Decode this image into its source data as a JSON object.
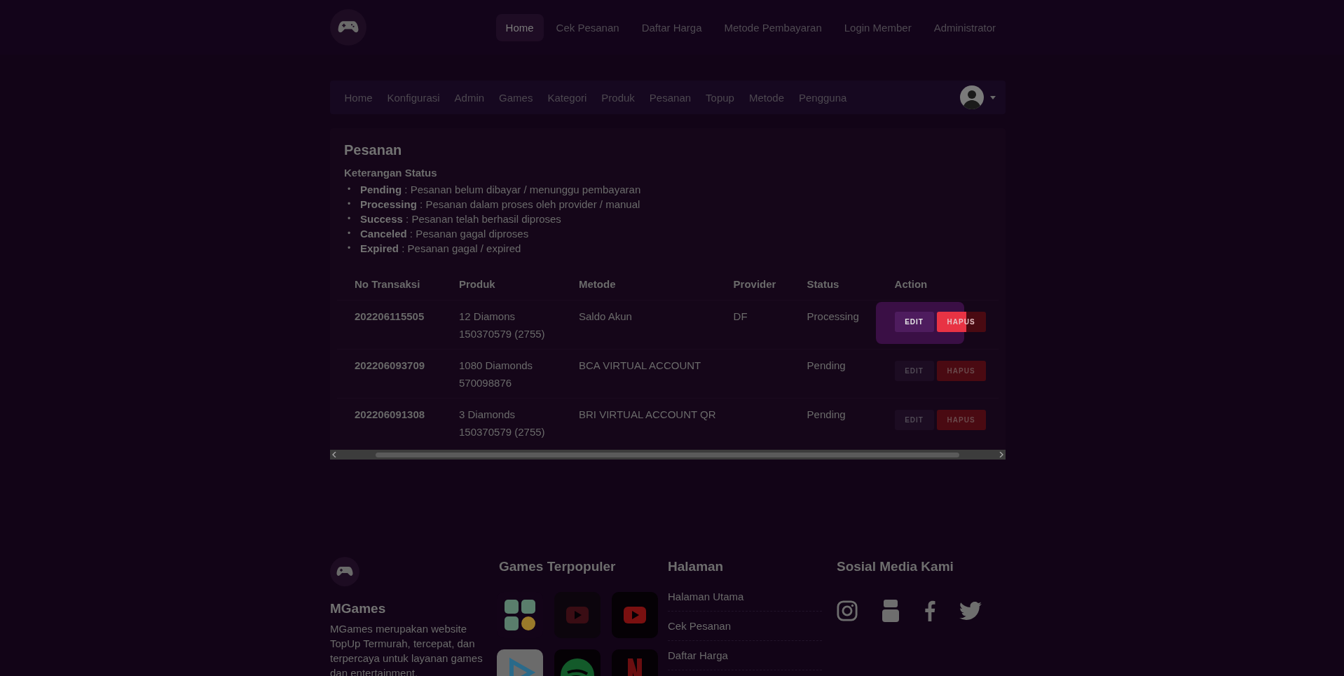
{
  "top_nav": {
    "items": [
      {
        "label": "Home",
        "selected": true
      },
      {
        "label": "Cek Pesanan",
        "selected": false
      },
      {
        "label": "Daftar Harga",
        "selected": false
      },
      {
        "label": "Metode Pembayaran",
        "selected": false
      },
      {
        "label": "Login Member",
        "selected": false
      },
      {
        "label": "Administrator",
        "selected": false
      }
    ]
  },
  "admin_nav": {
    "items": [
      "Home",
      "Konfigurasi",
      "Admin",
      "Games",
      "Kategori",
      "Produk",
      "Pesanan",
      "Topup",
      "Metode",
      "Pengguna"
    ]
  },
  "card": {
    "title": "Pesanan",
    "legend_title": "Keterangan Status",
    "legend": [
      {
        "bullet": "•",
        "text": "**Pending** : Pesanan belum dibayar / menunggu pembayaran"
      },
      {
        "bullet": "•",
        "text": "**Processing** : Pesanan dalam proses oleh provider / manual"
      },
      {
        "bullet": "•",
        "text": "**Success** : Pesanan telah berhasil diproses"
      },
      {
        "bullet": "•",
        "text": "**Canceled** : Pesanan gagal diproses"
      },
      {
        "bullet": "•",
        "text": "**Expired** : Pesanan gagal / expired"
      }
    ]
  },
  "table": {
    "columns": [
      "No Transaksi",
      "Produk",
      "Metode",
      "Provider",
      "Status",
      "Action"
    ],
    "rows": [
      {
        "no": "202206115505",
        "produk": [
          "12 Diamons",
          "150370579 (2755)"
        ],
        "metode": "Saldo Akun",
        "provider": "DF",
        "status": "Processing",
        "edit": "EDIT",
        "hapus": "HAPUS",
        "highlighted": true
      },
      {
        "no": "202206093709",
        "produk": [
          "1080 Diamonds",
          "570098876"
        ],
        "metode": "BCA VIRTUAL ACCOUNT",
        "provider": "",
        "status": "Pending",
        "edit": "EDIT",
        "hapus": "HAPUS",
        "highlighted": false
      },
      {
        "no": "202206091308",
        "produk": [
          "3 Diamonds",
          "150370579 (2755)"
        ],
        "metode": "BRI VIRTUAL ACCOUNT QR",
        "provider": "",
        "status": "Pending",
        "edit": "EDIT",
        "hapus": "HAPUS",
        "highlighted": false
      }
    ]
  },
  "footer": {
    "brand": "MGames",
    "description": "MGames merupakan website TopUp Termurah, tercepat, dan terpercaya untuk layanan games dan entertainment.",
    "games_title": "Games Terpopuler",
    "games": [
      {
        "kind": "wallet"
      },
      {
        "kind": "vidio"
      },
      {
        "kind": "youtube"
      },
      {
        "kind": "video"
      },
      {
        "kind": "spotify"
      },
      {
        "kind": "netflix"
      }
    ],
    "pages_title": "Halaman",
    "pages": [
      "Halaman Utama",
      "Cek Pesanan",
      "Daftar Harga"
    ],
    "social_title": "Sosial Media Kami",
    "social": [
      {
        "kind": "instagram"
      },
      {
        "kind": "youtube"
      },
      {
        "kind": "facebook"
      },
      {
        "kind": "twitter"
      }
    ]
  }
}
